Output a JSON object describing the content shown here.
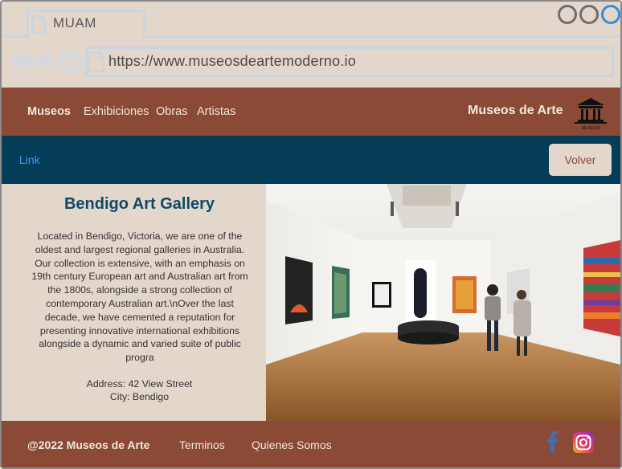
{
  "browser": {
    "tab_title": "MUAM",
    "url": "https://www.museosdeartemoderno.io"
  },
  "header": {
    "nav": [
      "Museos",
      "Exhibiciones",
      "Obras",
      "Artistas"
    ],
    "brand": "Museos de Arte",
    "logo_caption": "MUSEUM"
  },
  "subbar": {
    "link": "Link",
    "back_button": "Volver"
  },
  "gallery": {
    "title": "Bendigo Art Gallery",
    "description": "Located in Bendigo, Victoria, we are one of the oldest and largest regional galleries in Australia. Our collection is extensive, with an emphasis on 19th century European art and Australian art from the 1800s, alongside a strong collection of contemporary Australian art.\\nOver the last decade, we have cemented a reputation for presenting innovative international exhibitions alongside a dynamic and varied suite of public progra",
    "address": "Address: 42 View Street",
    "city": "City: Bendigo"
  },
  "footer": {
    "copyright": "@2022 Museos de Arte",
    "terms": "Terminos",
    "about": "Quienes Somos"
  },
  "colors": {
    "brown": "#8b4a36",
    "navy": "#053d58",
    "beige": "#e3d6cb",
    "link_blue": "#3d9cf0"
  }
}
